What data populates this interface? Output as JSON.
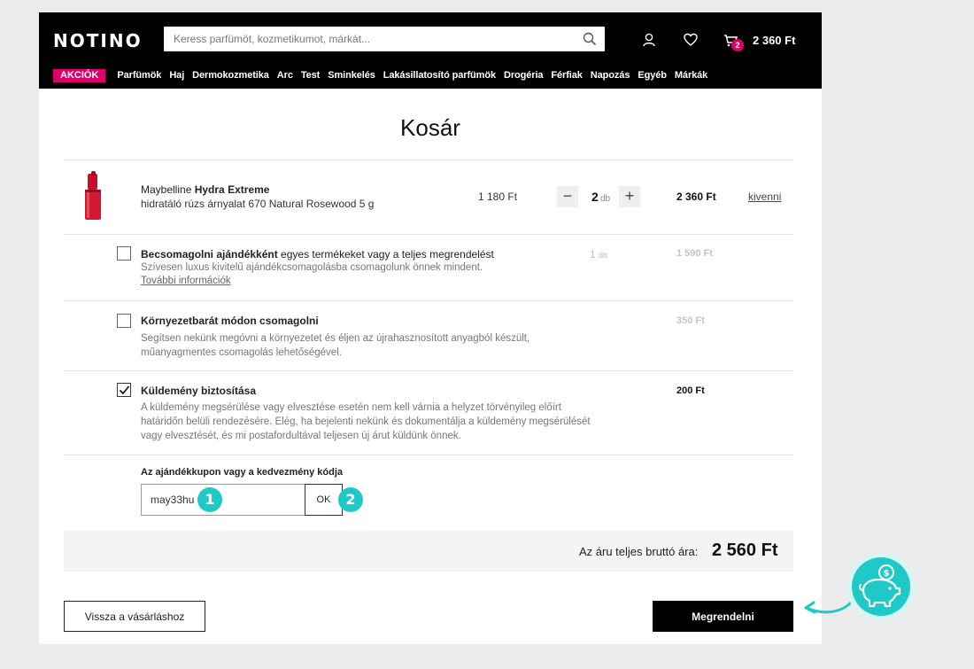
{
  "header": {
    "logo": "NOTINO",
    "search_placeholder": "Keress parfümöt, kozmetikumot, márkát...",
    "cart_count": "2",
    "cart_total": "2 360 Ft"
  },
  "nav": {
    "promo": "AKCIÓK",
    "items": [
      "Parfümök",
      "Haj",
      "Dermokozmetika",
      "Arc",
      "Test",
      "Sminkelés",
      "Lakásillatosító parfümök",
      "Drogéria",
      "Férfiak",
      "Napozás",
      "Egyéb",
      "Márkák"
    ]
  },
  "cart": {
    "title": "Kosár",
    "product": {
      "brand": "Maybelline",
      "name": "Hydra Extreme",
      "description": "hidratáló rúzs árnyalat 670 Natural Rosewood 5 g",
      "unit_price": "1 180 Ft",
      "quantity": "2",
      "quantity_unit": "db",
      "total": "2 360 Ft",
      "remove_label": "kivenni",
      "minus": "−",
      "plus": "+"
    },
    "options": {
      "gift": {
        "checked": false,
        "title_bold": "Becsomagolni ajándékként",
        "title_rest": " egyes termékeket vagy a teljes megrendelést",
        "text": "Szívesen luxus kivitelű ajándékcsomagolásba csomagolunk önnek mindent.",
        "link": "További információk",
        "quantity": "1",
        "quantity_unit": "db",
        "price": "1 590 Ft"
      },
      "eco": {
        "checked": false,
        "title_bold": "Környezetbarát módon csomagolni",
        "text": "Segítsen nekünk megóvni a környezetet és éljen az újrahasznosított anyagból készült, műanyagmentes csomagolás lehetőségével.",
        "price": "350 Ft"
      },
      "insurance": {
        "checked": true,
        "title_bold": "Küldemény biztosítása",
        "text": "A küldemény megsérülése vagy elvesztése esetén nem kell várnia a helyzet törvényileg előírt határidőn belüli rendezésére. Elég, ha bejelenti nekünk és dokumentálja a küldemény megsérülését vagy elvesztését, és mi postafordultával teljesen új árut küldünk önnek.",
        "price": "200 Ft"
      }
    },
    "coupon": {
      "label": "Az ajándékkupon vagy a kedvezmény kódja",
      "value": "may33hu",
      "button": "OK",
      "marker_1": "1",
      "marker_2": "2"
    },
    "summary": {
      "label": "Az áru teljes bruttó ára:",
      "total": "2 560 Ft"
    },
    "buttons": {
      "back": "Vissza a vásárláshoz",
      "order": "Megrendelni"
    }
  },
  "colors": {
    "brand_pink": "#dc0069",
    "marker_teal": "#1ec9c7",
    "header_bg": "#000000"
  }
}
